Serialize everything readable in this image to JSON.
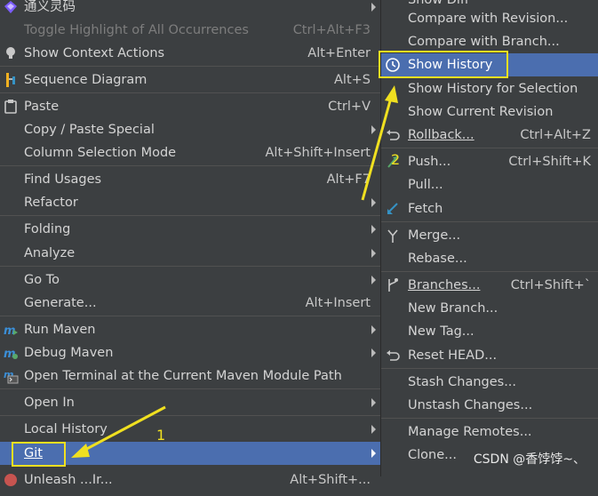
{
  "left_menu": {
    "items": [
      {
        "label": "通义灵码",
        "shortcut": "",
        "submenu": true,
        "icon": "tongyi-icon"
      },
      {
        "label": "Toggle Highlight of All Occurrences",
        "shortcut": "Ctrl+Alt+F3",
        "disabled": true
      },
      {
        "label": "Show Context Actions",
        "shortcut": "Alt+Enter",
        "icon": "bulb-icon"
      },
      {
        "label": "Sequence Diagram",
        "shortcut": "Alt+S",
        "icon": "sequence-diagram-icon"
      },
      {
        "label": "Paste",
        "shortcut": "Ctrl+V",
        "icon": "paste-icon"
      },
      {
        "label": "Copy / Paste Special",
        "submenu": true
      },
      {
        "label": "Column Selection Mode",
        "shortcut": "Alt+Shift+Insert"
      },
      {
        "label": "Find Usages",
        "shortcut": "Alt+F7"
      },
      {
        "label": "Refactor",
        "submenu": true
      },
      {
        "label": "Folding",
        "submenu": true
      },
      {
        "label": "Analyze",
        "submenu": true
      },
      {
        "label": "Go To",
        "submenu": true
      },
      {
        "label": "Generate...",
        "shortcut": "Alt+Insert"
      },
      {
        "label": "Run Maven",
        "submenu": true,
        "icon": "maven-run-icon"
      },
      {
        "label": "Debug Maven",
        "submenu": true,
        "icon": "maven-debug-icon"
      },
      {
        "label": "Open Terminal at the Current Maven Module Path",
        "icon": "maven-terminal-icon"
      },
      {
        "label": "Open In",
        "submenu": true
      },
      {
        "label": "Local History",
        "submenu": true
      },
      {
        "label": "Git",
        "submenu": true,
        "selected": true
      },
      {
        "label": "Unleash ...Ir...",
        "shortcut": "Alt+Shift+..."
      }
    ]
  },
  "right_menu": {
    "items": [
      {
        "label": "Show Diff"
      },
      {
        "label": "Compare with Revision..."
      },
      {
        "label": "Compare with Branch..."
      },
      {
        "label": "Show History",
        "selected": true,
        "icon": "clock-icon"
      },
      {
        "label": "Show History for Selection"
      },
      {
        "label": "Show Current Revision"
      },
      {
        "label": "Rollback...",
        "shortcut": "Ctrl+Alt+Z",
        "icon": "rollback-icon"
      },
      {
        "label": "Push...",
        "shortcut": "Ctrl+Shift+K",
        "icon": "push-icon"
      },
      {
        "label": "Pull..."
      },
      {
        "label": "Fetch",
        "icon": "fetch-icon"
      },
      {
        "label": "Merge...",
        "icon": "merge-icon"
      },
      {
        "label": "Rebase..."
      },
      {
        "label": "Branches...",
        "shortcut": "Ctrl+Shift+`",
        "icon": "branch-icon"
      },
      {
        "label": "New Branch..."
      },
      {
        "label": "New Tag..."
      },
      {
        "label": "Reset HEAD...",
        "icon": "reset-icon"
      },
      {
        "label": "Stash Changes..."
      },
      {
        "label": "Unstash Changes..."
      },
      {
        "label": "Manage Remotes..."
      },
      {
        "label": "Clone..."
      }
    ]
  },
  "annotations": {
    "marker_1": "1",
    "marker_2": "2",
    "highlight_color": "#f0e020"
  },
  "watermark": "CSDN @香饽饽~、",
  "colors": {
    "menu_bg": "#3c3f41",
    "selected_bg": "#4b6eaf",
    "text": "#d4d4d4"
  }
}
